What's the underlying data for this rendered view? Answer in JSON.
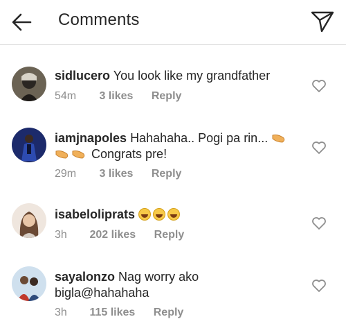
{
  "header": {
    "title": "Comments",
    "back_icon": "arrow-left-icon",
    "send_icon": "paper-plane-icon"
  },
  "comments": [
    {
      "username": "sidlucero",
      "text": "You look like my grandfather",
      "time": "54m",
      "likes": "3 likes",
      "reply": "Reply"
    },
    {
      "username": "iamjnapoles",
      "text": "Hahahaha.. Pogi pa rin...",
      "text_line2": "Congrats pre!",
      "time": "29m",
      "likes": "3 likes",
      "reply": "Reply"
    },
    {
      "username": "isabeloliprats",
      "text": "",
      "time": "3h",
      "likes": "202 likes",
      "reply": "Reply"
    },
    {
      "username": "sayalonzo",
      "text": "Nag worry ako",
      "text_line2": "bigla@hahahaha",
      "time": "3h",
      "likes": "115 likes",
      "reply": "Reply"
    }
  ],
  "colors": {
    "text": "#262626",
    "muted": "#8e8e8e",
    "divider": "#dbdbdb"
  }
}
